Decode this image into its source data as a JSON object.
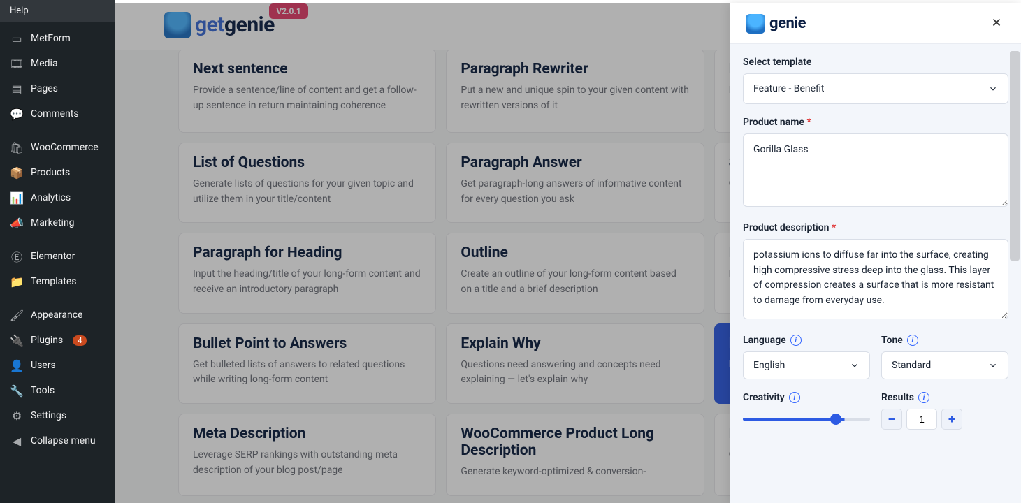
{
  "topbar": {
    "logo_text": "genie",
    "version_badge": "V2.0.1"
  },
  "sidebar": {
    "help": "Help",
    "collapse": "Collapse menu",
    "groups": [
      {
        "items": [
          {
            "icon": "▭",
            "label": "MetForm"
          },
          {
            "icon": "🎞",
            "label": "Media"
          },
          {
            "icon": "▤",
            "label": "Pages"
          },
          {
            "icon": "💬",
            "label": "Comments"
          }
        ]
      },
      {
        "items": [
          {
            "icon": "🛍",
            "label": "WooCommerce"
          },
          {
            "icon": "📦",
            "label": "Products"
          },
          {
            "icon": "📊",
            "label": "Analytics"
          },
          {
            "icon": "📣",
            "label": "Marketing"
          }
        ]
      },
      {
        "items": [
          {
            "icon": "Ⓔ",
            "label": "Elementor"
          },
          {
            "icon": "📁",
            "label": "Templates"
          }
        ]
      },
      {
        "items": [
          {
            "icon": "🖌",
            "label": "Appearance"
          },
          {
            "icon": "🔌",
            "label": "Plugins",
            "badge": "4"
          },
          {
            "icon": "👤",
            "label": "Users"
          },
          {
            "icon": "🔧",
            "label": "Tools"
          },
          {
            "icon": "⚙",
            "label": "Settings"
          }
        ]
      }
    ]
  },
  "cards": [
    [
      {
        "title": "Next sentence",
        "desc": "Provide a sentence/line of content and get a follow-up sentence in return maintaining coherence"
      },
      {
        "title": "Paragraph Rewriter",
        "desc": "Put a new and unique spin to your given content with rewritten versions of it"
      },
      {
        "title": "N",
        "desc": "I c"
      }
    ],
    [
      {
        "title": "List of Questions",
        "desc": "Generate lists of questions for your given topic and utilize them in your title/content"
      },
      {
        "title": "Paragraph Answer",
        "desc": "Get paragraph-long answers of informative content for every question you ask"
      },
      {
        "title": "S",
        "desc": "G t"
      }
    ],
    [
      {
        "title": "Paragraph for Heading",
        "desc": "Input the heading/title of your long-form content and receive an introductory paragraph"
      },
      {
        "title": "Outline",
        "desc": "Create an outline of your long-form content based on a title and a brief description"
      },
      {
        "title": "P",
        "desc": "N w"
      }
    ],
    [
      {
        "title": "Bullet Point to Answers",
        "desc": "Get bulleted lists of answers to related questions while writing long-form content"
      },
      {
        "title": "Explain Why",
        "desc": "Questions need answering and concepts need explaining — let's explain why"
      },
      {
        "title": "F",
        "desc": "D t",
        "blue": true
      }
    ],
    [
      {
        "title": "Meta Description",
        "desc": "Leverage SERP rankings with outstanding meta description of your blog post/page"
      },
      {
        "title": "WooCommerce Product Long Description",
        "desc": "Generate keyword-optimized & conversion-"
      },
      {
        "title": "P",
        "desc": "G t"
      }
    ]
  ],
  "panel": {
    "logo_text": "genie",
    "select_template_label": "Select template",
    "select_template_value": "Feature - Benefit",
    "product_name_label": "Product name",
    "product_name_value": "Gorilla Glass",
    "product_desc_label": "Product description",
    "product_desc_value": "potassium ions to diffuse far into the surface, creating high compressive stress deep into the glass. This layer of compression creates a surface that is more resistant to damage from everyday use.",
    "language_label": "Language",
    "language_value": "English",
    "tone_label": "Tone",
    "tone_value": "Standard",
    "creativity_label": "Creativity",
    "creativity_value": "4",
    "results_label": "Results",
    "results_value": "1"
  }
}
